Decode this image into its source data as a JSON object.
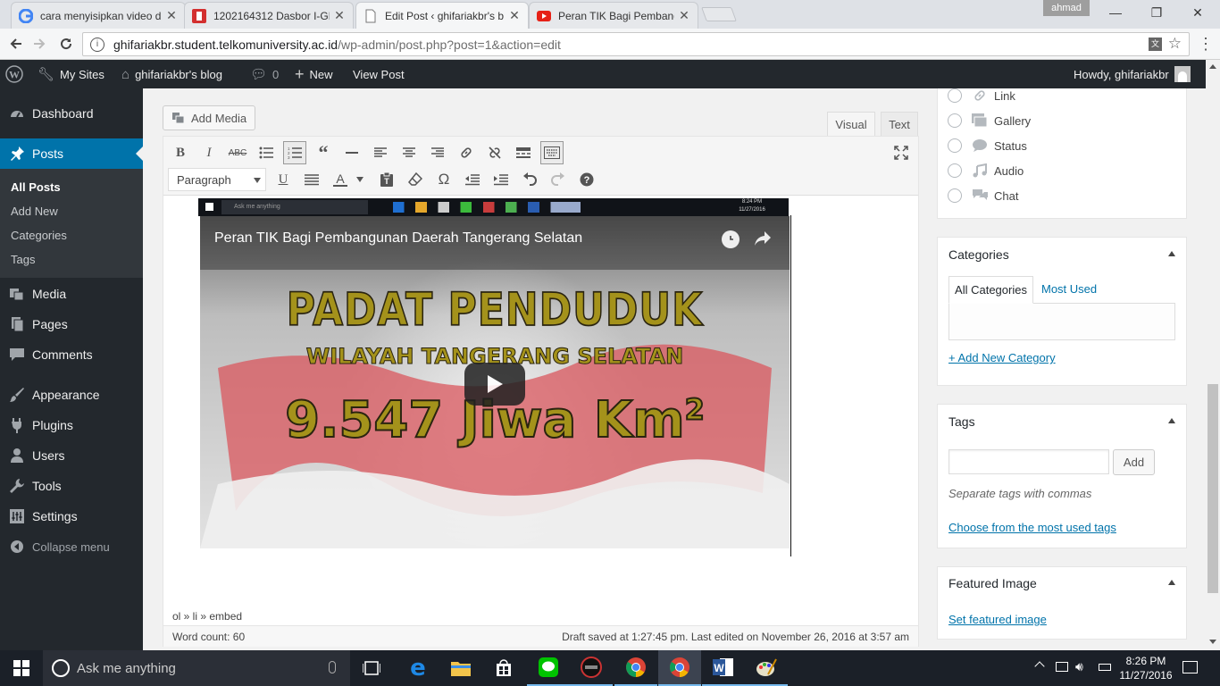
{
  "browser": {
    "tabs": [
      {
        "title": "cara menyisipkan video d",
        "favicon": "google-icon"
      },
      {
        "title": "1202164312 Dasbor I-GR",
        "favicon": "igracias-icon"
      },
      {
        "title": "Edit Post ‹ ghifariakbr's b",
        "favicon": "page-icon"
      },
      {
        "title": "Peran TIK Bagi Pembang",
        "favicon": "youtube-icon"
      }
    ],
    "profile": "ahmad",
    "url_host": "ghifariakbr.student.telkomuniversity.ac.id",
    "url_path": "/wp-admin/post.php?post=1&action=edit"
  },
  "adminbar": {
    "my_sites": "My Sites",
    "site_name": "ghifariakbr's blog",
    "comments_count": "0",
    "new": "New",
    "view_post": "View Post",
    "howdy": "Howdy, ghifariakbr"
  },
  "sidebar": {
    "dashboard": "Dashboard",
    "posts": "Posts",
    "sub": [
      "All Posts",
      "Add New",
      "Categories",
      "Tags"
    ],
    "media": "Media",
    "pages": "Pages",
    "comments": "Comments",
    "appearance": "Appearance",
    "plugins": "Plugins",
    "users": "Users",
    "tools": "Tools",
    "settings": "Settings",
    "collapse": "Collapse menu"
  },
  "editor": {
    "add_media": "Add Media",
    "tab_visual": "Visual",
    "tab_text": "Text",
    "format_select": "Paragraph",
    "video_title": "Peran TIK Bagi Pembangunan Daerah Tangerang Selatan",
    "video_text_line1": "PADAT PENDUDUK",
    "video_text_line2": "WILAYAH TANGERANG SELATAN",
    "video_text_line3": "9.547 Jiwa Km",
    "video_text_sup": "2",
    "embedded_taskbar_search": "Ask me anything",
    "embedded_time": "8:24 PM",
    "embedded_date": "11/27/2016",
    "path": "ol » li » embed",
    "word_count": "Word count: 60",
    "draft_status": "Draft saved at 1:27:45 pm. Last edited on November 26, 2016 at 3:57 am"
  },
  "format": {
    "items": [
      "Link",
      "Gallery",
      "Status",
      "Audio",
      "Chat"
    ]
  },
  "categories": {
    "title": "Categories",
    "tab_all": "All Categories",
    "tab_most": "Most Used",
    "add_new": "+ Add New Category"
  },
  "tags": {
    "title": "Tags",
    "add_button": "Add",
    "hint": "Separate tags with commas",
    "choose": "Choose from the most used tags"
  },
  "featured": {
    "title": "Featured Image",
    "set": "Set featured image"
  },
  "taskbar": {
    "search": "Ask me anything",
    "time": "8:26 PM",
    "date": "11/27/2016"
  }
}
